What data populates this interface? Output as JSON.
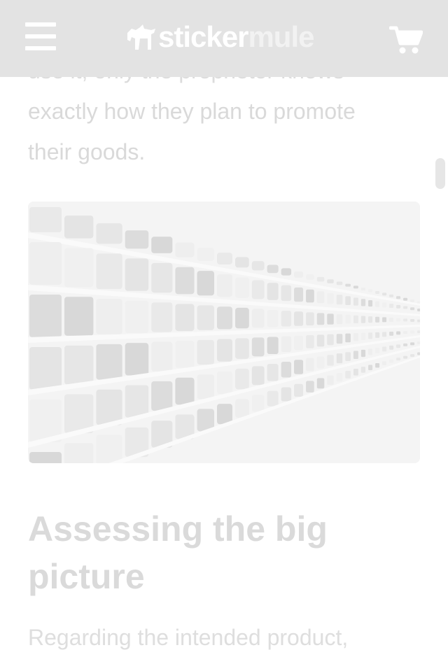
{
  "header": {
    "logo": {
      "word_primary": "sticker",
      "word_secondary": "mule"
    },
    "menu_icon": "hamburger-menu-icon",
    "cart_icon": "shopping-cart-icon"
  },
  "article": {
    "intro_lines": [
      "use it, only the proprietor knows",
      "exactly how they plan to promote",
      "their goods."
    ],
    "image": {
      "subject": "shelves of cans"
    },
    "section_heading": "Assessing the big picture",
    "body_lines": [
      "Regarding the intended product,"
    ]
  },
  "colors": {
    "header_bg": "#e3e3e3",
    "text_faded": "#dadada",
    "header_fg": "#ffffff"
  }
}
